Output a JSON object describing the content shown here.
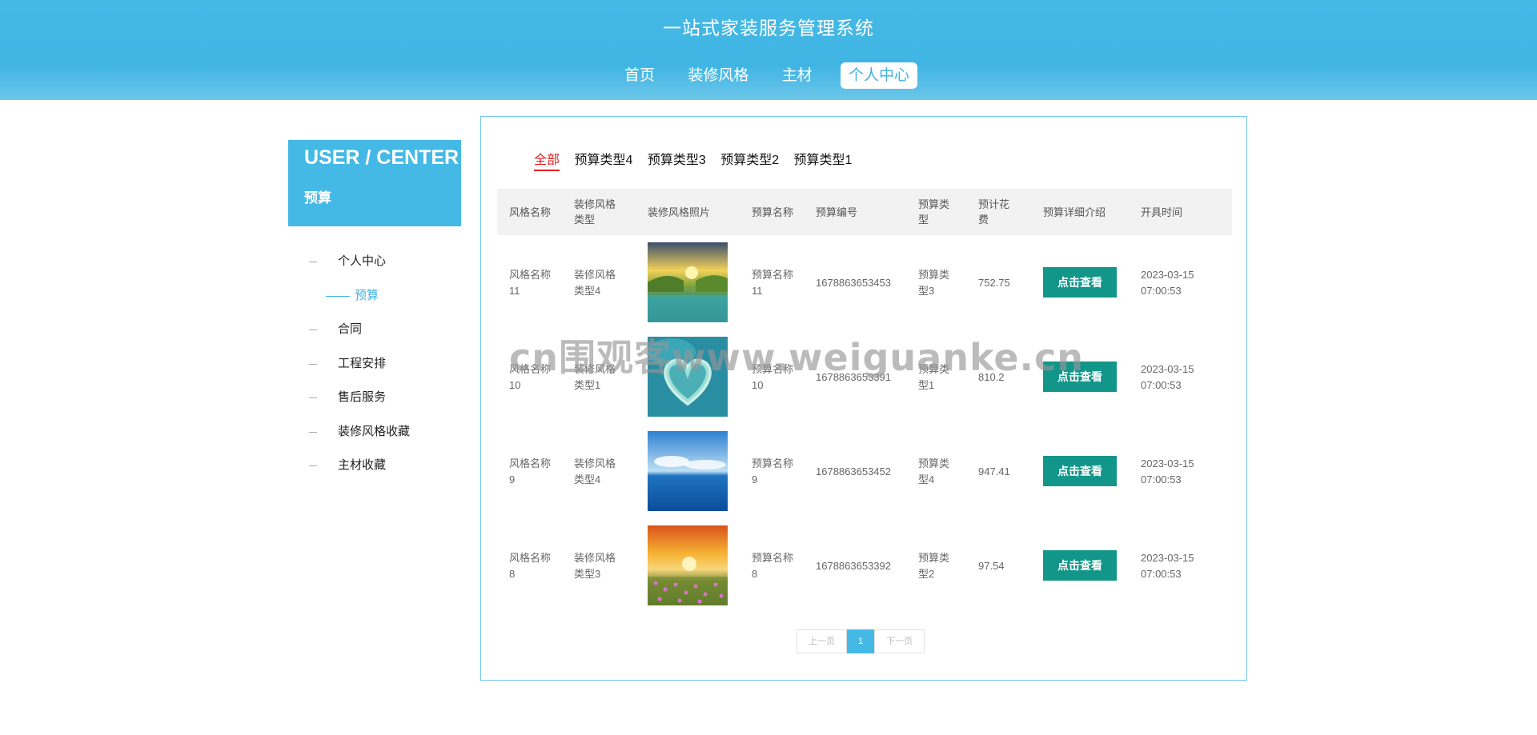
{
  "header": {
    "title": "一站式家装服务管理系统",
    "nav": [
      "首页",
      "装修风格",
      "主材",
      "个人中心"
    ],
    "active_nav": "个人中心"
  },
  "sidebar": {
    "title": "USER / CENTER",
    "subtitle": "预算",
    "items": [
      "个人中心",
      "预算",
      "合同",
      "工程安排",
      "售后服务",
      "装修风格收藏",
      "主材收藏"
    ],
    "active_item": "预算"
  },
  "filters": {
    "items": [
      "全部",
      "预算类型4",
      "预算类型3",
      "预算类型2",
      "预算类型1"
    ],
    "active": "全部"
  },
  "table": {
    "headers": [
      "风格名称",
      "装修风格类型",
      "装修风格照片",
      "预算名称",
      "预算编号",
      "预算类型",
      "预计花费",
      "预算详细介绍",
      "开具时间"
    ],
    "rows": [
      {
        "style_name": "风格名称11",
        "style_type": "装修风格类型4",
        "photo": "lake-sunrise-photo",
        "budget_name": "预算名称11",
        "budget_no": "1678863653453",
        "budget_type": "预算类型3",
        "cost": "752.75",
        "detail_button": "点击查看",
        "date": "2023-03-15",
        "time": "07:00:53"
      },
      {
        "style_name": "风格名称10",
        "style_type": "装修风格类型1",
        "photo": "heart-island-photo",
        "budget_name": "预算名称10",
        "budget_no": "1678863653391",
        "budget_type": "预算类型1",
        "cost": "810.2",
        "detail_button": "点击查看",
        "date": "2023-03-15",
        "time": "07:00:53"
      },
      {
        "style_name": "风格名称9",
        "style_type": "装修风格类型4",
        "photo": "sea-sky-photo",
        "budget_name": "预算名称9",
        "budget_no": "1678863653452",
        "budget_type": "预算类型4",
        "cost": "947.41",
        "detail_button": "点击查看",
        "date": "2023-03-15",
        "time": "07:00:53"
      },
      {
        "style_name": "风格名称8",
        "style_type": "装修风格类型3",
        "photo": "flower-field-sunset-photo",
        "budget_name": "预算名称8",
        "budget_no": "1678863653392",
        "budget_type": "预算类型2",
        "cost": "97.54",
        "detail_button": "点击查看",
        "date": "2023-03-15",
        "time": "07:00:53"
      }
    ]
  },
  "pagination": {
    "prev": "上一页",
    "current": "1",
    "next": "下一页"
  },
  "watermark": "cn围观客www.weiguanke.cn",
  "colors": {
    "header_blue": "#44b9e6",
    "active_filter_red": "#e31d1d",
    "button_teal": "#13968a",
    "border_blue": "#6dc7ec"
  }
}
